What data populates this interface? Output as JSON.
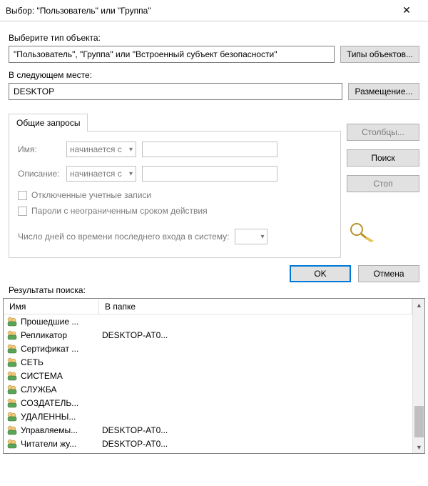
{
  "window": {
    "title": "Выбор: \"Пользователь\" или \"Группа\""
  },
  "labels": {
    "select_object_type": "Выберите тип объекта:",
    "object_type_value": "\"Пользователь\", \"Группа\" или \"Встроенный субъект безопасности\"",
    "object_types_btn": "Типы объектов...",
    "in_location": "В следующем месте:",
    "location_value": "DESKTOP",
    "locations_btn": "Размещение...",
    "tab_common": "Общие запросы",
    "name": "Имя:",
    "description": "Описание:",
    "starts_with": "начинается с",
    "chk_disabled": "Отключенные учетные записи",
    "chk_nonexpiring": "Пароли с неограниченным сроком действия",
    "days_label": "Число дней со времени последнего входа в систему:",
    "columns_btn": "Столбцы...",
    "find_btn": "Поиск",
    "stop_btn": "Стоп",
    "ok": "OK",
    "cancel": "Отмена",
    "results": "Результаты поиска:",
    "col_name": "Имя",
    "col_folder": "В папке"
  },
  "results": [
    {
      "icon": "group",
      "name": "Прошедшие ...",
      "folder": ""
    },
    {
      "icon": "group",
      "name": "Репликатор",
      "folder": "DESKTOP-AT0..."
    },
    {
      "icon": "group",
      "name": "Сертификат ...",
      "folder": ""
    },
    {
      "icon": "group",
      "name": "СЕТЬ",
      "folder": ""
    },
    {
      "icon": "group",
      "name": "СИСТЕМА",
      "folder": ""
    },
    {
      "icon": "group",
      "name": "СЛУЖБА",
      "folder": ""
    },
    {
      "icon": "group",
      "name": "СОЗДАТЕЛЬ...",
      "folder": ""
    },
    {
      "icon": "group",
      "name": "УДАЛЕННЫ...",
      "folder": ""
    },
    {
      "icon": "group",
      "name": "Управляемы...",
      "folder": "DESKTOP-AT0..."
    },
    {
      "icon": "group",
      "name": "Читатели жу...",
      "folder": "DESKTOP-AT0..."
    }
  ]
}
